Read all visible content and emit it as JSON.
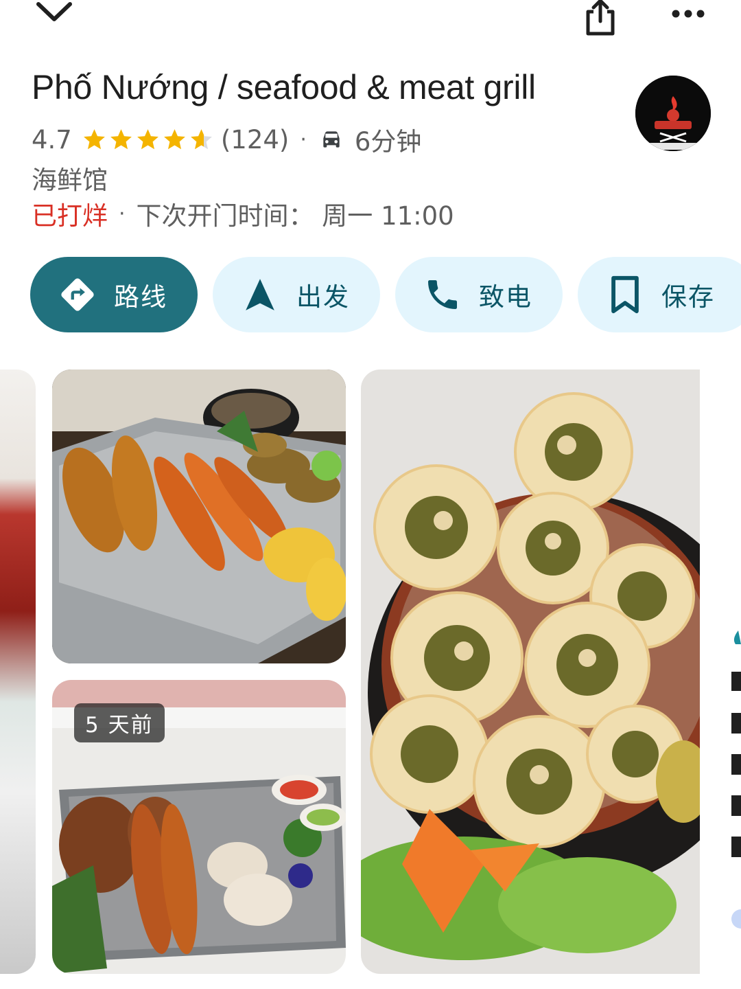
{
  "header": {
    "title": "Phố Nướng / seafood & meat grill",
    "rating": "4.7",
    "rating_stars": 4.7,
    "review_count": "(124)",
    "drive_time": "6分钟",
    "category": "海鲜馆",
    "status": "已打烊",
    "next_open": "下次开门时间： 周一 11:00"
  },
  "actions": [
    {
      "label": "路线",
      "icon": "directions-icon"
    },
    {
      "label": "出发",
      "icon": "navigation-arrow-icon"
    },
    {
      "label": "致电",
      "icon": "phone-icon"
    },
    {
      "label": "保存",
      "icon": "bookmark-icon"
    }
  ],
  "photos": {
    "badge": "5 天前"
  },
  "colors": {
    "primary_button": "#21717e",
    "secondary_button": "#e3f5fd",
    "closed_red": "#d93025",
    "star_gold": "#f4b400"
  }
}
